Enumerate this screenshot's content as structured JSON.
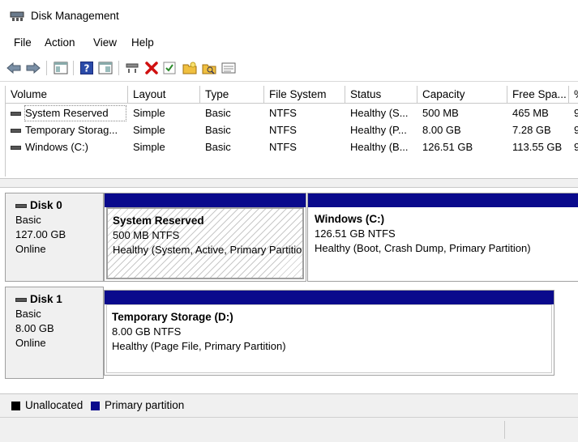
{
  "window": {
    "title": "Disk Management"
  },
  "menu": [
    "File",
    "Action",
    "View",
    "Help"
  ],
  "toolbar": {
    "icons": [
      "back-arrow-icon",
      "forward-arrow-icon",
      "console-tree-icon",
      "help-icon",
      "properties-icon",
      "connect-icon",
      "delete-icon",
      "check-icon",
      "new-folder-icon",
      "search-folder-icon",
      "list-view-icon"
    ]
  },
  "volume_list": {
    "columns": [
      "Volume",
      "Layout",
      "Type",
      "File System",
      "Status",
      "Capacity",
      "Free Spa...",
      "%"
    ],
    "rows": [
      [
        "System Reserved",
        "Simple",
        "Basic",
        "NTFS",
        "Healthy (S...",
        "500 MB",
        "465 MB",
        "9"
      ],
      [
        "Temporary Storag...",
        "Simple",
        "Basic",
        "NTFS",
        "Healthy (P...",
        "8.00 GB",
        "7.28 GB",
        "9"
      ],
      [
        "Windows (C:)",
        "Simple",
        "Basic",
        "NTFS",
        "Healthy (B...",
        "126.51 GB",
        "113.55 GB",
        "9"
      ]
    ]
  },
  "disks": [
    {
      "name": "Disk 0",
      "type": "Basic",
      "size": "127.00 GB",
      "status": "Online",
      "partitions": [
        {
          "title": "System Reserved",
          "size": "500 MB NTFS",
          "status": "Healthy (System, Active, Primary Partition)",
          "selected": true
        },
        {
          "title": "Windows  (C:)",
          "size": "126.51 GB NTFS",
          "status": "Healthy (Boot, Crash Dump, Primary Partition)",
          "selected": false
        }
      ]
    },
    {
      "name": "Disk 1",
      "type": "Basic",
      "size": "8.00 GB",
      "status": "Online",
      "partitions": [
        {
          "title": "Temporary Storage  (D:)",
          "size": "8.00 GB NTFS",
          "status": "Healthy (Page File, Primary Partition)",
          "selected": false
        }
      ]
    }
  ],
  "legend": [
    {
      "label": "Unallocated",
      "color": "#000000"
    },
    {
      "label": "Primary partition",
      "color": "#0a0a8c"
    }
  ],
  "colors": {
    "primary_partition": "#0a0a8c",
    "unallocated": "#000000"
  }
}
